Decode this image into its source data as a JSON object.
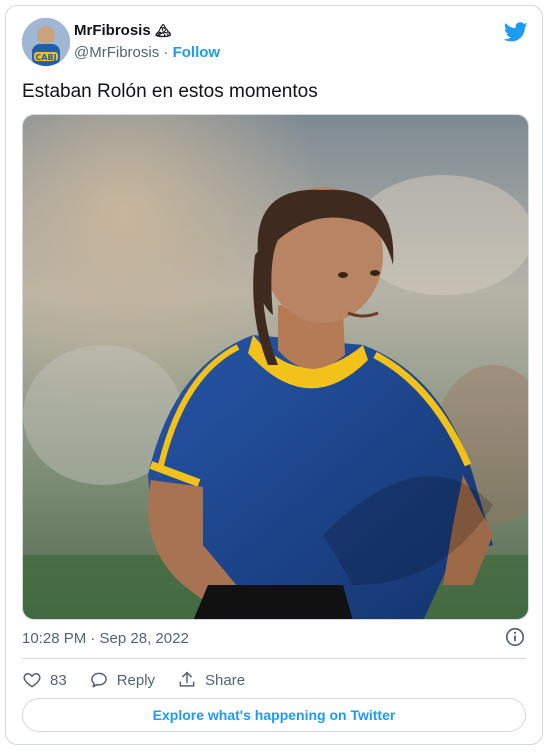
{
  "author": {
    "display_name": "MrFibrosis",
    "name_emoji": "🏔",
    "handle": "@MrFibrosis",
    "separator": " · ",
    "follow_label": "Follow",
    "avatar_text": "CABJ"
  },
  "tweet": {
    "text": "Estaban Rolón en estos momentos",
    "timestamp": "10:28 PM · Sep 28, 2022"
  },
  "actions": {
    "likes_count": "83",
    "reply_label": "Reply",
    "share_label": "Share"
  },
  "explore_label": "Explore what's happening on Twitter",
  "colors": {
    "brand_blue": "#1d9bf0",
    "text_primary": "#0f1419",
    "text_secondary": "#536471",
    "border": "#cfd9de",
    "jersey_blue": "#1e4fa0",
    "jersey_yellow": "#f2c21a"
  },
  "icons": [
    "twitter-bird-icon",
    "info-icon",
    "heart-icon",
    "reply-icon",
    "share-icon"
  ]
}
